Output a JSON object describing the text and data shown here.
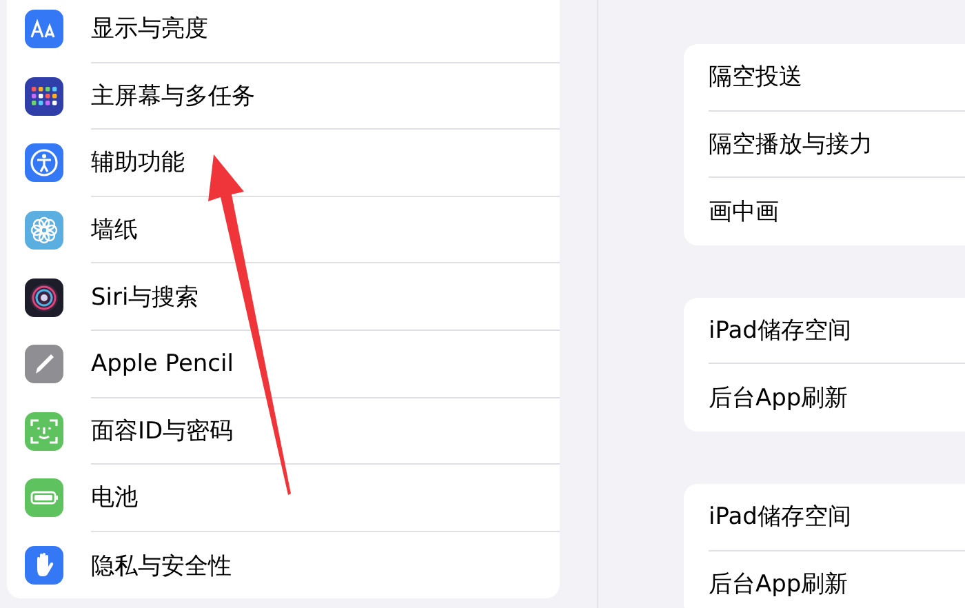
{
  "sidebar": {
    "items": [
      {
        "label": "显示与亮度"
      },
      {
        "label": "主屏幕与多任务"
      },
      {
        "label": "辅助功能"
      },
      {
        "label": "墙纸"
      },
      {
        "label": "Siri与搜索"
      },
      {
        "label": "Apple Pencil"
      },
      {
        "label": "面容ID与密码"
      },
      {
        "label": "电池"
      },
      {
        "label": "隐私与安全性"
      }
    ]
  },
  "detail": {
    "groups": [
      {
        "items": [
          {
            "label": "隔空投送"
          },
          {
            "label": "隔空播放与接力"
          },
          {
            "label": "画中画"
          }
        ]
      },
      {
        "items": [
          {
            "label": "iPad储存空间"
          },
          {
            "label": "后台App刷新"
          }
        ]
      },
      {
        "items": [
          {
            "label": "iPad储存空间"
          },
          {
            "label": "后台App刷新"
          }
        ]
      }
    ]
  }
}
